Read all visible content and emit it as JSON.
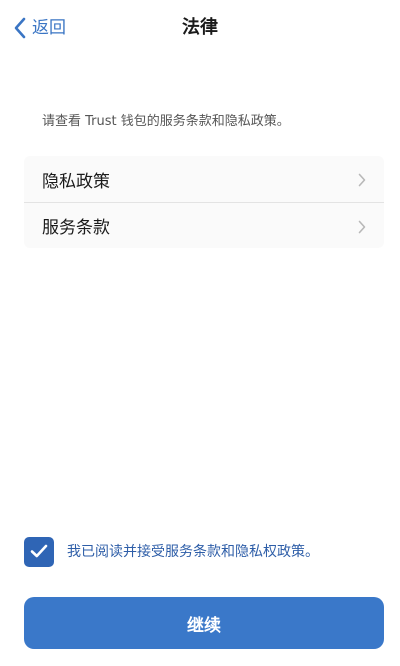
{
  "nav": {
    "back_label": "返回",
    "back_icon": "chevron-left-icon",
    "title": "法律"
  },
  "intro": {
    "text": "请查看 Trust 钱包的服务条款和隐私政策。"
  },
  "legal_list": {
    "items": [
      {
        "label": "隐私政策",
        "icon": "chevron-right-icon"
      },
      {
        "label": "服务条款",
        "icon": "chevron-right-icon"
      }
    ]
  },
  "consent": {
    "checked": true,
    "label": "我已阅读并接受服务条款和隐私权政策。",
    "icon": "checkmark-icon"
  },
  "continue_button": {
    "label": "继续"
  },
  "colors": {
    "accent": "#3a78c9",
    "checkbox": "#2f65b5",
    "link_text": "#2e5ea8",
    "background": "#ffffff",
    "list_background": "#fafafa"
  }
}
